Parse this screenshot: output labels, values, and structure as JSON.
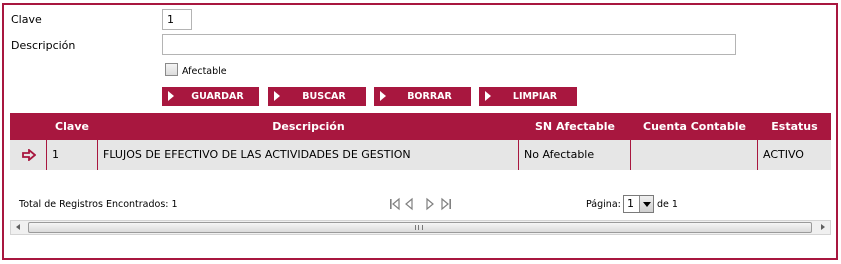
{
  "form": {
    "clave_label": "Clave",
    "clave_value": "1",
    "descripcion_label": "Descripción",
    "descripcion_value": "",
    "afectable_label": "Afectable",
    "afectable_checked": false
  },
  "buttons": {
    "guardar": "GUARDAR",
    "buscar": "BUSCAR",
    "borrar": "BORRAR",
    "limpiar": "LIMPIAR"
  },
  "table": {
    "columns": [
      "Clave",
      "Descripción",
      "SN Afectable",
      "Cuenta Contable",
      "Estatus"
    ],
    "rows": [
      {
        "clave": "1",
        "descripcion": "FLUJOS DE EFECTIVO DE LAS ACTIVIDADES DE GESTION",
        "sn_afectable": "No Afectable",
        "cuenta_contable": "",
        "estatus": "ACTIVO"
      }
    ]
  },
  "footer": {
    "total_text": "Total de Registros Encontrados: 1",
    "page_label": "Página:",
    "page_value": "1",
    "page_of": "de 1"
  },
  "colors": {
    "accent": "#a8173f",
    "row_bg": "#e6e6e6"
  },
  "icons": {
    "row_selector": "arrow-right-icon",
    "pager": [
      "first-page-icon",
      "prev-page-icon",
      "next-page-icon",
      "last-page-icon"
    ]
  }
}
